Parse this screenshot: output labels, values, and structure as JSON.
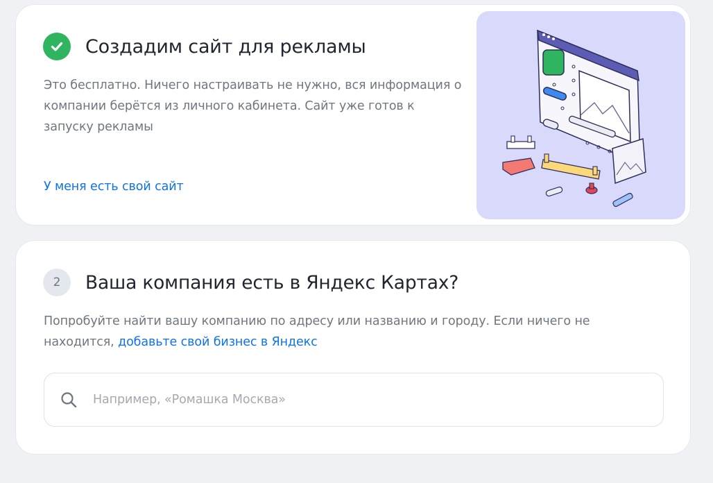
{
  "card_create_site": {
    "title": "Создадим сайт для рекламы",
    "description": "Это бесплатно. Ничего настраивать не нужно, вся информация о компании берётся из личного кабинета. Сайт уже готов к запуску рекламы",
    "own_site_link": "У меня есть свой сайт",
    "status_icon": "check-circle-icon"
  },
  "card_yandex_maps": {
    "step_number": "2",
    "title": "Ваша компания есть в Яндекс Картах?",
    "description_prefix": "Попробуйте найти вашу компанию по адресу или названию и городу. Если ничего не находится, ",
    "description_link": "добавьте свой бизнес в Яндекс",
    "search": {
      "icon": "search-icon",
      "value": "",
      "placeholder": "Например, «Ромашка Москва»"
    }
  },
  "colors": {
    "accent_link": "#0f73e6",
    "success": "#2fb45f",
    "illustration_bg": "#d9d9fc"
  }
}
